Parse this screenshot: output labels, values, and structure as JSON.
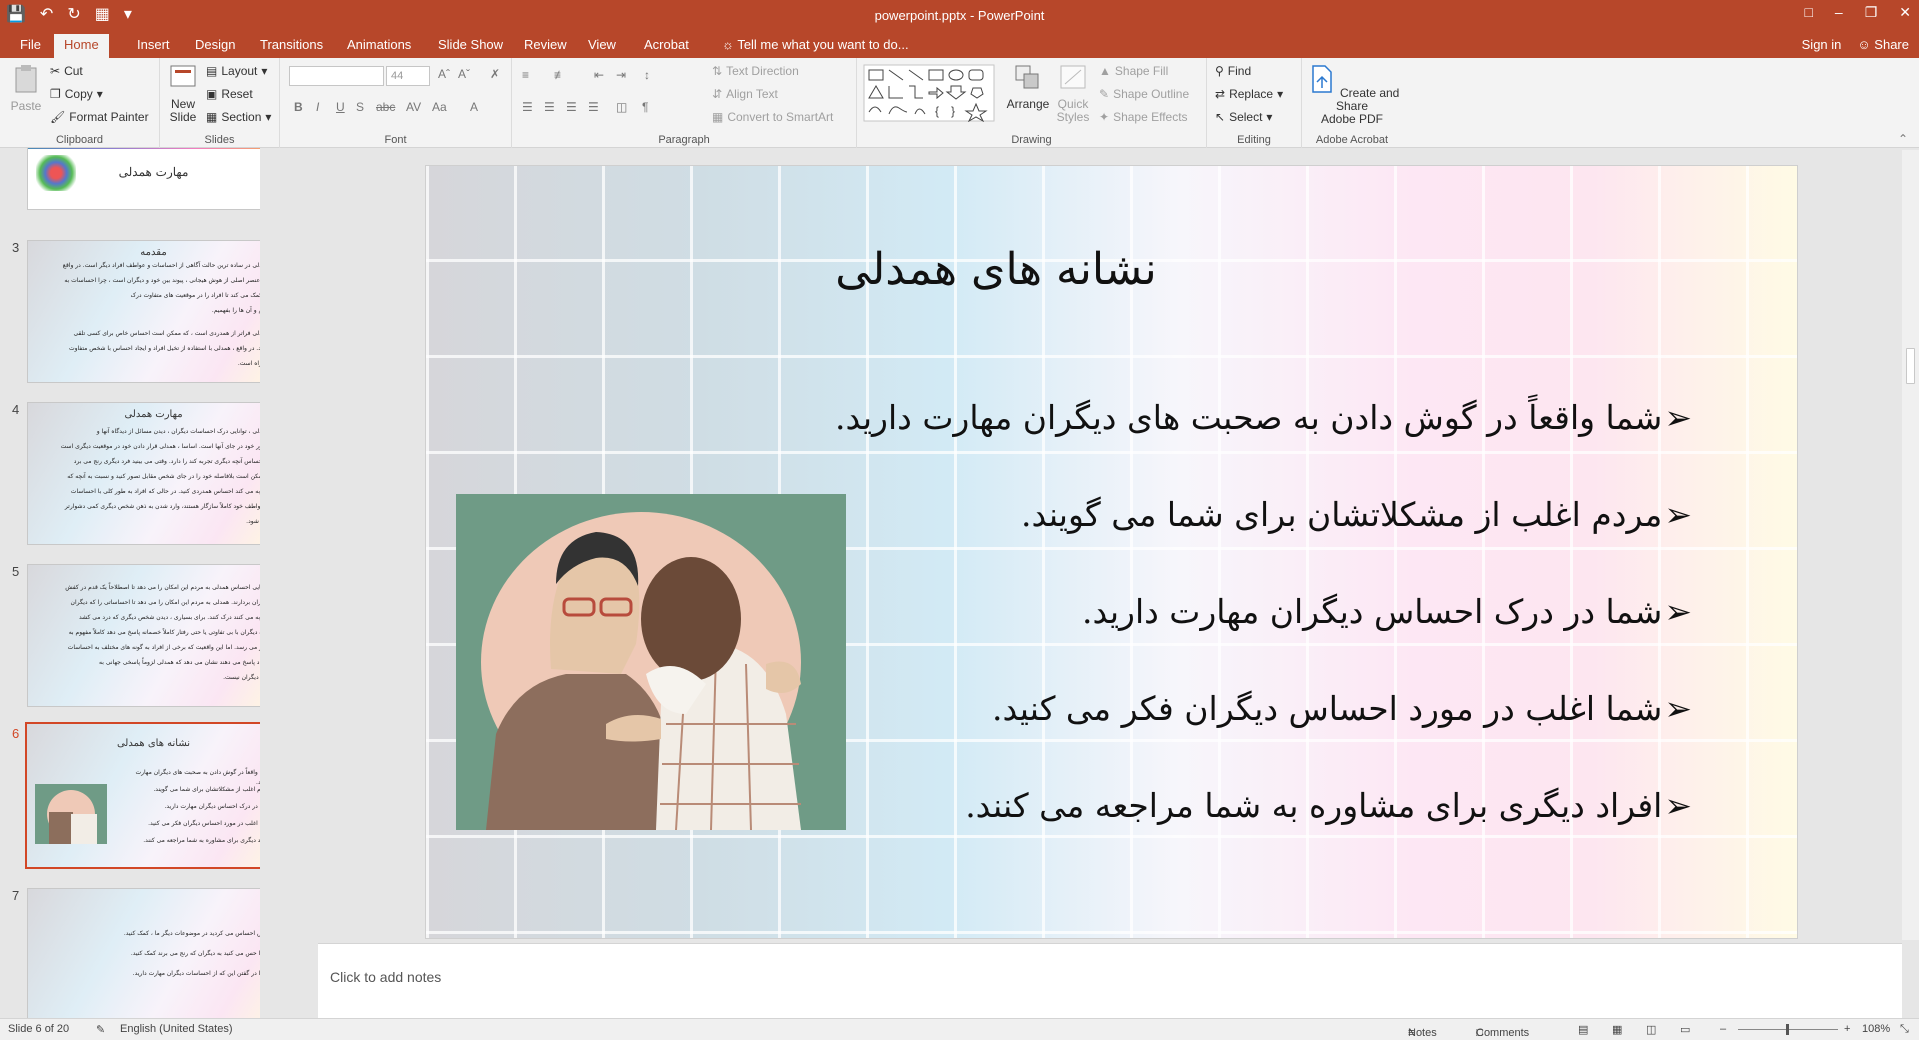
{
  "window": {
    "doc_title": "powerpoint.pptx - PowerPoint"
  },
  "tabs": [
    "File",
    "Home",
    "Insert",
    "Design",
    "Transitions",
    "Animations",
    "Slide Show",
    "Review",
    "View",
    "Acrobat"
  ],
  "active_tab": "Home",
  "tell_me": "Tell me what you want to do...",
  "account": {
    "sign_in": "Sign in",
    "share": "Share"
  },
  "ribbon": {
    "clipboard": {
      "label": "Clipboard",
      "paste": "Paste",
      "cut": "Cut",
      "copy": "Copy",
      "format_painter": "Format Painter"
    },
    "slides": {
      "label": "Slides",
      "new_slide_1": "New",
      "new_slide_2": "Slide",
      "layout": "Layout",
      "reset": "Reset",
      "section": "Section"
    },
    "font": {
      "label": "Font",
      "font_size": "44"
    },
    "paragraph": {
      "label": "Paragraph",
      "text_direction": "Text Direction",
      "align_text": "Align Text",
      "convert_smartart": "Convert to SmartArt"
    },
    "drawing": {
      "label": "Drawing",
      "arrange": "Arrange",
      "quick_styles_1": "Quick",
      "quick_styles_2": "Styles",
      "shape_fill": "Shape Fill",
      "shape_outline": "Shape Outline",
      "shape_effects": "Shape Effects"
    },
    "editing": {
      "label": "Editing",
      "find": "Find",
      "replace": "Replace",
      "select": "Select"
    },
    "acrobat": {
      "label": "Adobe Acrobat",
      "create_1": "Create and Share",
      "create_2": "Adobe PDF"
    }
  },
  "thumbnails": [
    {
      "number": "",
      "title": "مهارت همدلی"
    },
    {
      "number": "3",
      "title": "مقدمه",
      "lines": [
        "همدلی در ساده ترین حالت آگاهی از احساسات و عواطف افراد دیگر است. در واقع",
        "یک عنصر اصلی از هوش هیجانی ، پیوند بین خود و دیگران است ، چرا احساسات به",
        "ما کمک می کند تا افراد را در موقعیت های متفاوت درک",
        "کنیم و آن ها را بفهمیم.",
        "همدلی فراتر از همدردی است ، که ممکن است احساس خاص برای کسی تلقی",
        "شود. در واقع ، همدلی با استفاده از تخیل افراد و ایجاد احساس با شخص متفاوت",
        "همراه است."
      ]
    },
    {
      "number": "4",
      "title": "مهارت همدلی",
      "lines": [
        "همدلی ، توانایی درک احساسات دیگران ، دیدن مسائل از دیدگاه آنها و",
        "تصور خود در جای آنها است. اساسا ، همدلی قرار دادن خود در موقعیت دیگری است",
        "و احساس آنچه دیگری تجربه کند را دارد. وقتی می بینید فرد دیگری رنج می برد",
        "، ممکن است بلافاصله خود را در جای شخص مقابل تصور کنید و نسبت به آنچه که",
        "تجربه می کند احساس همدردی کنید. در حالی که افراد به طور کلی با احساسات",
        "و عواطف خود کاملاً سازگار هستند، وارد شدن به ذهن شخص دیگری کمی دشوارتر",
        "می شود."
      ]
    },
    {
      "number": "5",
      "lines": [
        "توانایی احساس همدلی به مردم این امکان را می دهد تا اصطلاحاً یک قدم در کفش",
        "دیگران بردارند. همدلی به مردم این امکان را می دهد تا احساساتی را که دیگران",
        "تجربه می کنند درک کنند. برای بسیاری ، دیدن شخص دیگری که درد می کشد",
        "و به دیگران با بی تفاوتی یا حتی رفتار کاملاً خصمانه پاسخ می دهد کاملاً مفهوم به",
        "نظر می رسد. اما این واقعیت که برخی از افراد به گونه های مختلف به احساسات",
        "افراد پاسخ می دهند نشان می دهد که همدلی لزوماً پاسخی جهانی به",
        "رنج دیگران نیست."
      ]
    },
    {
      "number": "6",
      "title": "نشانه های همدلی"
    },
    {
      "number": "7",
      "lines": [
        "کاش احساس می کردید در موضوعات دیگر ما ، کمک کنید.",
        "شما حس می کنید به دیگران که رنج می برند کمک کنید.",
        "شما در گفتن این که از احساسات دیگران مهارت دارید."
      ]
    }
  ],
  "slide": {
    "title": "نشانه های همدلی",
    "bullets": [
      "شما واقعاً در گوش دادن به صحبت های دیگران مهارت دارید.",
      "مردم اغلب از مشکلاتشان برای شما می گویند.",
      "شما در درک احساس دیگران مهارت دارید.",
      "شما اغلب در مورد احساس دیگران فکر می کنید.",
      "افراد دیگری برای مشاوره به شما مراجعه می کنند."
    ]
  },
  "notes_placeholder": "Click to add notes",
  "status": {
    "slide_counter": "Slide 6 of 20",
    "language": "English (United States)",
    "notes": "Notes",
    "comments": "Comments",
    "zoom": "108%"
  }
}
